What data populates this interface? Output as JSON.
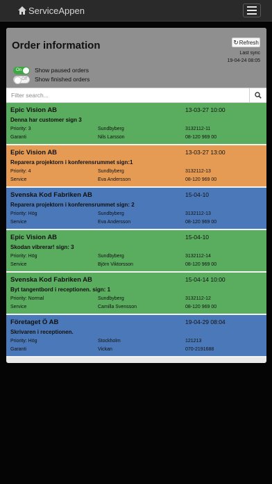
{
  "navbar": {
    "brand": "ServiceAppen"
  },
  "header": {
    "title": "Order information",
    "refresh_label": "Refresh",
    "last_sync_label": "Last sync",
    "last_sync_value": "19-04-24 08:05"
  },
  "toggles": [
    {
      "label": "Show paused orders",
      "state_label": "On",
      "on": true
    },
    {
      "label": "Show finished orders",
      "state_label": "Off",
      "on": false
    }
  ],
  "search": {
    "placeholder": "Filter search..."
  },
  "colors": {
    "green": "#5aac5e",
    "orange": "#e69b55",
    "blue": "#4a78b8",
    "header_gray": "#8f8f8f"
  },
  "orders": [
    {
      "customer": "Epic Vision AB",
      "date": "13-03-27 10:00",
      "description": "Denna har customer sign 3",
      "priority": "Priority: 3",
      "location": "Sundbyberg",
      "order_no": "3132112-11",
      "type": "Garanti",
      "technician": "Nils Larsson",
      "phone": "08-120 969 00",
      "color": "#5aac5e"
    },
    {
      "customer": "Epic Vision AB",
      "date": "13-03-27 13:00",
      "description": "Reparera projektorn i konferensrummet sign:1",
      "priority": "Priority: 4",
      "location": "Sundbyberg",
      "order_no": "3132112-13",
      "type": "Service",
      "technician": "Eva Andersson",
      "phone": "08-120 969 00",
      "color": "#e69b55"
    },
    {
      "customer": "Svenska Kod Fabriken AB",
      "date": "15-04-10",
      "description": "Reparera projektorn i konferensrummet sign: 2",
      "priority": "Priority: Hög",
      "location": "Sundbyberg",
      "order_no": "3132112-13",
      "type": "Service",
      "technician": "Eva Andersson",
      "phone": "08-120 969 00",
      "color": "#4a78b8"
    },
    {
      "customer": "Epic Vision AB",
      "date": "15-04-10",
      "description": "Skodan vibrerar! sign: 3",
      "priority": "Priority: Hög",
      "location": "Sundbyberg",
      "order_no": "3132112-14",
      "type": "Service",
      "technician": "Björn Viktorsson",
      "phone": "08-120 969 00",
      "color": "#5aac5e"
    },
    {
      "customer": "Svenska Kod Fabriken AB",
      "date": "15-04-14 10:00",
      "description": "Byt tangentbord i receptionen. sign: 1",
      "priority": "Priority: Normal",
      "location": "Sundbyberg",
      "order_no": "3132112-12",
      "type": "Service",
      "technician": "Camilla Svensson",
      "phone": "08-120 969 00",
      "color": "#5aac5e"
    },
    {
      "customer": "Företaget Ö AB",
      "date": "19-04-29 08:04",
      "description": "Skrivaren i receptionen.",
      "priority": "Priority: Hög",
      "location": "Stockholm",
      "order_no": "121213",
      "type": "Garanti",
      "technician": "Vickan",
      "phone": "070-2191688",
      "color": "#4a78b8"
    }
  ]
}
